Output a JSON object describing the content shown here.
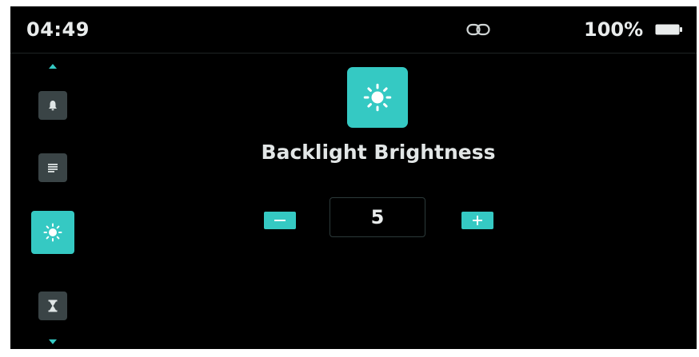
{
  "status_bar": {
    "time": "04:49",
    "battery_percent": "100%",
    "icons": [
      "link-icon",
      "battery-icon"
    ]
  },
  "sidebar": {
    "items": [
      {
        "icon": "bell-icon",
        "active": false
      },
      {
        "icon": "lines-icon",
        "active": false
      },
      {
        "icon": "brightness-icon",
        "active": true
      },
      {
        "icon": "hourglass-icon",
        "active": false
      }
    ],
    "scroll_icons": [
      "arrow-up-icon",
      "arrow-down-icon"
    ]
  },
  "main": {
    "icon": "brightness-icon",
    "title": "Backlight Brightness",
    "value": "5",
    "decrement_icon": "minus-icon",
    "increment_icon": "plus-icon"
  },
  "colors": {
    "accent": "#35c9c3",
    "background": "#000000",
    "inactive_button": "#3a4446",
    "text": "#e2e6e6"
  }
}
